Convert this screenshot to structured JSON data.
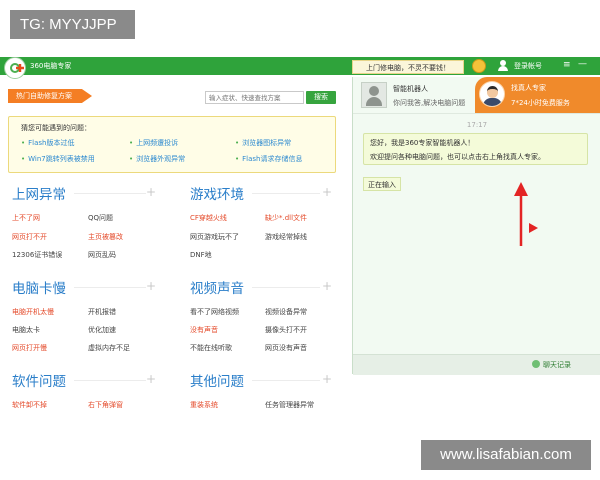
{
  "watermarks": {
    "top": "TG: MYYJJPP",
    "bottom": "www.lisafabian.com"
  },
  "titlebar": {
    "app_title": "360电脑专家",
    "promo": "上门修电脑，不灵不要钱！",
    "login": "登录帐号",
    "menu_icon": "≡",
    "min_icon": "—"
  },
  "search": {
    "hot_tab": "热门自助修复方案",
    "placeholder": "输入症状、快速查找方案",
    "button": "搜索"
  },
  "guess": {
    "title": "猜您可能遇到的问题：",
    "items": [
      "Flash版本过低",
      "上网频遭投诉",
      "浏览器图标异常",
      "Win7跳转列表被禁用",
      "浏览器外观异常",
      "Flash请求存储信息"
    ]
  },
  "categories": [
    {
      "title": "上网异常",
      "items": [
        "上不了网",
        "QQ问题",
        "网页打不开",
        "主页被篡改",
        "12306证书错误",
        "网页乱码"
      ]
    },
    {
      "title": "游戏环境",
      "items": [
        "CF穿越火线",
        "缺少*.dll文件",
        "网页游戏玩不了",
        "游戏经常掉线",
        "DNF地",
        ""
      ]
    },
    {
      "title": "电脑卡慢",
      "items": [
        "电脑开机太慢",
        "开机报错",
        "电脑太卡",
        "优化加速",
        "网页打开慢",
        "虚拟内存不足"
      ]
    },
    {
      "title": "视频声音",
      "items": [
        "看不了网络视频",
        "视频设备异常",
        "没有声音",
        "摄像头打不开",
        "不能在线听歌",
        "网页没有声音"
      ]
    },
    {
      "title": "软件问题",
      "items": [
        "软件卸不掉",
        "右下角弹窗",
        "重装系统",
        "任务管理器异常",
        "",
        ""
      ]
    },
    {
      "title": "其他问题",
      "items": []
    }
  ],
  "chat": {
    "robot_name": "智能机器人",
    "robot_sub": "你问我答,解决电脑问题",
    "expert_name": "找真人专家",
    "expert_sub": "7*24小时免费服务",
    "time": "17:17",
    "message_line1": "您好，我是360专家智能机器人！",
    "message_line2": "欢迎提问各种电脑问题，也可以点击右上角找真人专家。",
    "typing": "正在输入",
    "history": "聊天记录"
  },
  "colors": {
    "titlebar": "#2fa33b",
    "accent_orange": "#f08a2b",
    "link_blue": "#2a7ec9",
    "link_red": "#e44a2a",
    "arrow_red": "#e32424"
  }
}
